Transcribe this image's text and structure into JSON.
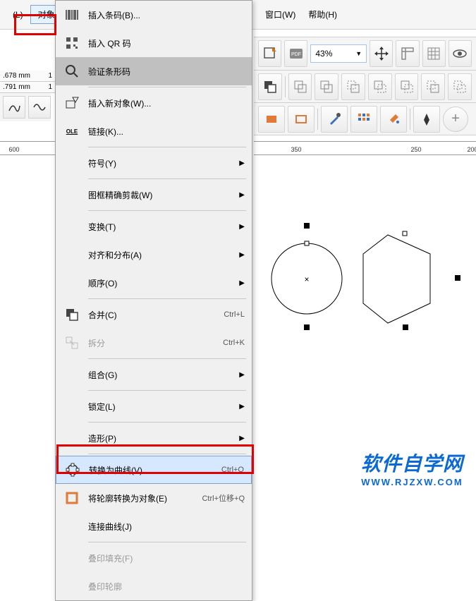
{
  "menubar": {
    "layout": "(L)",
    "object": "对象(C)",
    "window": "窗口(W)",
    "help": "帮助(H)"
  },
  "toolbar": {
    "zoom": "43%"
  },
  "coords": {
    "x": ".678 mm",
    "y": ".791 mm",
    "xk": "1",
    "yk": "1"
  },
  "ruler": {
    "t600": "600",
    "t350": "350",
    "t250": "250",
    "t200": "200"
  },
  "menu": {
    "insert_barcode": "插入条码(B)...",
    "insert_qr": "插入 QR 码",
    "verify_barcode": "验证条形码",
    "insert_object": "插入新对象(W)...",
    "links": "链接(K)...",
    "symbol": "符号(Y)",
    "frame_crop": "图框精确剪裁(W)",
    "transform": "变换(T)",
    "align": "对齐和分布(A)",
    "order": "顺序(O)",
    "combine": "合并(C)",
    "combine_sc": "Ctrl+L",
    "split": "拆分",
    "split_sc": "Ctrl+K",
    "group": "组合(G)",
    "lock": "锁定(L)",
    "shape": "造形(P)",
    "to_curve": "转换为曲线(V)",
    "to_curve_sc": "Ctrl+Q",
    "outline_to_obj": "将轮廓转换为对象(E)",
    "outline_sc": "Ctrl+位移+Q",
    "join_curve": "连接曲线(J)",
    "overprint_fill": "叠印填充(F)",
    "overprint_outline": "叠印轮廓"
  },
  "watermark": {
    "title": "软件自学网",
    "url": "WWW.RJZXW.COM"
  }
}
